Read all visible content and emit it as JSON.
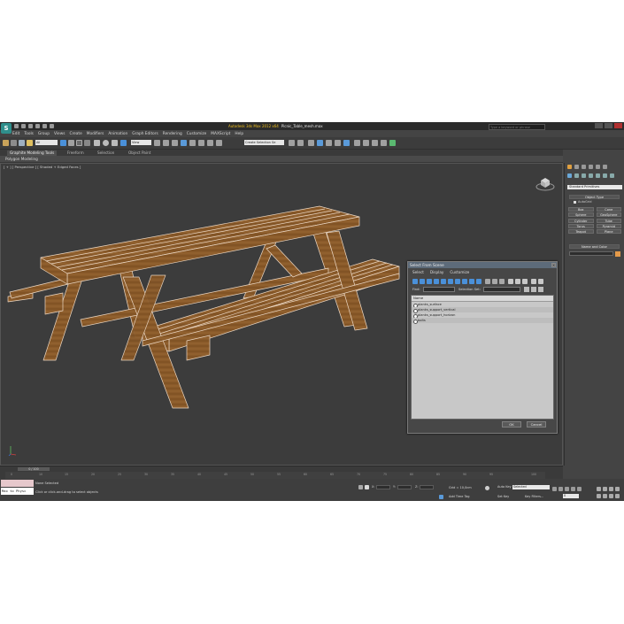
{
  "window": {
    "app_name": "Autodesk 3ds Max 2012 x64",
    "file_name": "Picnic_Table_mesh.max",
    "search_placeholder": "Type a keyword or phrase"
  },
  "app_logo": "S",
  "menu": [
    "Edit",
    "Tools",
    "Group",
    "Views",
    "Create",
    "Modifiers",
    "Animation",
    "Graph Editors",
    "Rendering",
    "Customize",
    "MAXScript",
    "Help"
  ],
  "toolbar": {
    "filter_dropdown": "All",
    "view_dropdown": "View",
    "selection_set_dropdown": "Create Selection Se"
  },
  "ribbon": {
    "tabs": [
      "Graphite Modeling Tools",
      "Freeform",
      "Selection",
      "Object Paint"
    ],
    "panel_label": "Polygon Modeling"
  },
  "viewport": {
    "label": "[ + ] [ Perspective ] [ Shaded + Edged Faces ]"
  },
  "command_panel": {
    "category_dropdown": "Standard Primitives",
    "object_type_header": "Object Type",
    "autogrid_label": "AutoGrid",
    "primitives": [
      "Box",
      "Cone",
      "Sphere",
      "GeoSphere",
      "Cylinder",
      "Tube",
      "Torus",
      "Pyramid",
      "Teapot",
      "Plane"
    ],
    "name_color_header": "Name and Color"
  },
  "select_dialog": {
    "title": "Select From Scene",
    "menu": [
      "Select",
      "Display",
      "Customize"
    ],
    "find_label": "Find:",
    "selection_set_label": "Selection Set:",
    "column_header": "Name",
    "items": [
      "planks_surface",
      "planks_support_vertical",
      "planks_support_horizon",
      "bolts"
    ],
    "ok_label": "OK",
    "cancel_label": "Cancel"
  },
  "timeline": {
    "slider_label": "0 / 100",
    "ticks": [
      "0",
      "10",
      "15",
      "20",
      "25",
      "30",
      "35",
      "40",
      "45",
      "50",
      "55",
      "60",
      "65",
      "70",
      "75",
      "80",
      "85",
      "90",
      "95",
      "100"
    ]
  },
  "status": {
    "maxscript_text": "Max to Physc",
    "selection_status": "None Selected",
    "prompt": "Click or click-and-drag to select objects",
    "grid": "Grid = 10,0cm",
    "auto_key_label": "Auto Key",
    "auto_key_dropdown": "Selected",
    "set_key_label": "Set Key",
    "key_filters_label": "Key Filters...",
    "add_time_tag": "Add Time Tag",
    "frame_field": "0"
  },
  "colors": {
    "title_accent": "#f0c020",
    "wood": "#8a5a2a",
    "wood_edge": "#e8d0b8",
    "viewport_bg": "#3c3c3c",
    "selection_swatch": "#e49a4a"
  }
}
